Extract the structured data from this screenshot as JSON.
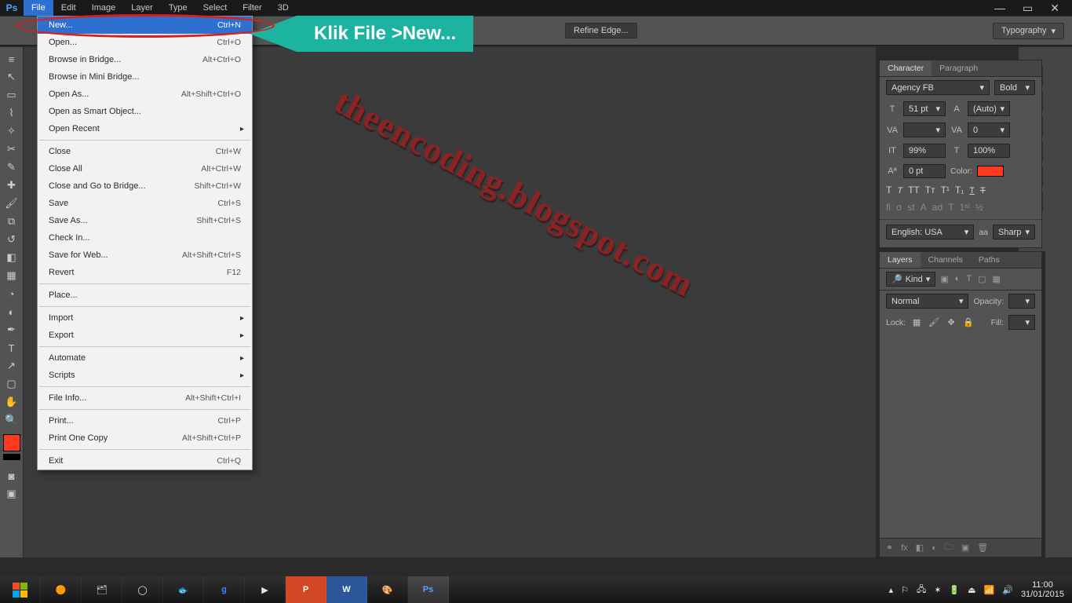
{
  "app": {
    "logo": "Ps"
  },
  "menubar": [
    "File",
    "Edit",
    "Image",
    "Layer",
    "Type",
    "Select",
    "Filter",
    "3D"
  ],
  "menubar_active": "File",
  "optionsbar": {
    "refine": "Refine Edge...",
    "workspace": "Typography"
  },
  "file_menu": [
    {
      "label": "New...",
      "shortcut": "Ctrl+N",
      "hl": true
    },
    {
      "label": "Open...",
      "shortcut": "Ctrl+O"
    },
    {
      "label": "Browse in Bridge...",
      "shortcut": "Alt+Ctrl+O"
    },
    {
      "label": "Browse in Mini Bridge..."
    },
    {
      "label": "Open As...",
      "shortcut": "Alt+Shift+Ctrl+O"
    },
    {
      "label": "Open as Smart Object..."
    },
    {
      "label": "Open Recent",
      "sub": true
    },
    {
      "sep": true
    },
    {
      "label": "Close",
      "shortcut": "Ctrl+W"
    },
    {
      "label": "Close All",
      "shortcut": "Alt+Ctrl+W"
    },
    {
      "label": "Close and Go to Bridge...",
      "shortcut": "Shift+Ctrl+W"
    },
    {
      "label": "Save",
      "shortcut": "Ctrl+S"
    },
    {
      "label": "Save As...",
      "shortcut": "Shift+Ctrl+S"
    },
    {
      "label": "Check In..."
    },
    {
      "label": "Save for Web...",
      "shortcut": "Alt+Shift+Ctrl+S"
    },
    {
      "label": "Revert",
      "shortcut": "F12"
    },
    {
      "sep": true
    },
    {
      "label": "Place..."
    },
    {
      "sep": true
    },
    {
      "label": "Import",
      "sub": true
    },
    {
      "label": "Export",
      "sub": true
    },
    {
      "sep": true
    },
    {
      "label": "Automate",
      "sub": true
    },
    {
      "label": "Scripts",
      "sub": true
    },
    {
      "sep": true
    },
    {
      "label": "File Info...",
      "shortcut": "Alt+Shift+Ctrl+I"
    },
    {
      "sep": true
    },
    {
      "label": "Print...",
      "shortcut": "Ctrl+P"
    },
    {
      "label": "Print One Copy",
      "shortcut": "Alt+Shift+Ctrl+P"
    },
    {
      "sep": true
    },
    {
      "label": "Exit",
      "shortcut": "Ctrl+Q"
    }
  ],
  "callout": "Klik File >New...",
  "watermark": "theencoding.blogspot.com",
  "char_panel": {
    "tabs": [
      "Character",
      "Paragraph"
    ],
    "font": "Agency FB",
    "style": "Bold",
    "size": "51 pt",
    "leading": "(Auto)",
    "kerning": "",
    "tracking": "0",
    "vscale": "99%",
    "hscale": "100%",
    "baseline": "0 pt",
    "color_label": "Color:",
    "lang": "English: USA",
    "aa_label": "aa",
    "aa": "Sharp"
  },
  "layer_panel": {
    "tabs": [
      "Layers",
      "Channels",
      "Paths"
    ],
    "kind": "Kind",
    "blend": "Normal",
    "opacity_label": "Opacity:",
    "lock_label": "Lock:",
    "fill_label": "Fill:"
  },
  "systray": {
    "time": "11:00",
    "date": "31/01/2015"
  }
}
